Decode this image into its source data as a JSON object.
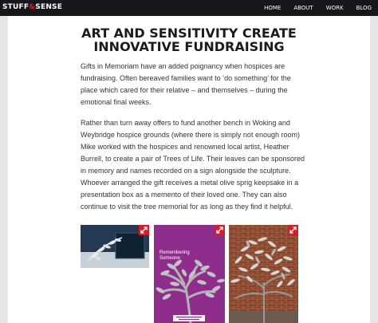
{
  "nav": {
    "logo_left": "STUFF",
    "logo_amp": "&",
    "logo_right": "SENSE",
    "links": [
      "HOME",
      "ABOUT",
      "WORK",
      "BLOG"
    ]
  },
  "article": {
    "title_line1": "ART AND SENSITIVITY CREATE",
    "title_line2": "INNOVATIVE FUNDRAISING",
    "paragraph1": "Gifts in Memoriam have an added poignancy when hospices are fundraising. Often bereaved families want to ‘do something’ for the place which cared for their relative – and themselves – during the emotional final weeks.",
    "paragraph2": "Rather than turn away offers to fund another bench in Woking and Weybridge hospice grounds (where there is simply not enough room) Mike worked with the hospices and renowned local artist, Heather Burrell, to create a pair of Trees of Life. Their leaves can be sponsored in memory and names recorded on a sign alongside the sculpture. Whoever arranged the gift receives a metal olive sprig keepsake in a presentation box as a memento of their loved one. They can also continue to visit the tree memorial for as long as they find it helpful."
  },
  "gallery": {
    "cover_caption_line1": "Remembering",
    "cover_caption_line2": "Someone",
    "expand_icon": "expand-arrows-icon",
    "colors": {
      "accent": "#d01f2c",
      "cover_purple": "#8e2d8b",
      "box_navy": "#1a2f43",
      "brick": "#7a3a25"
    }
  }
}
